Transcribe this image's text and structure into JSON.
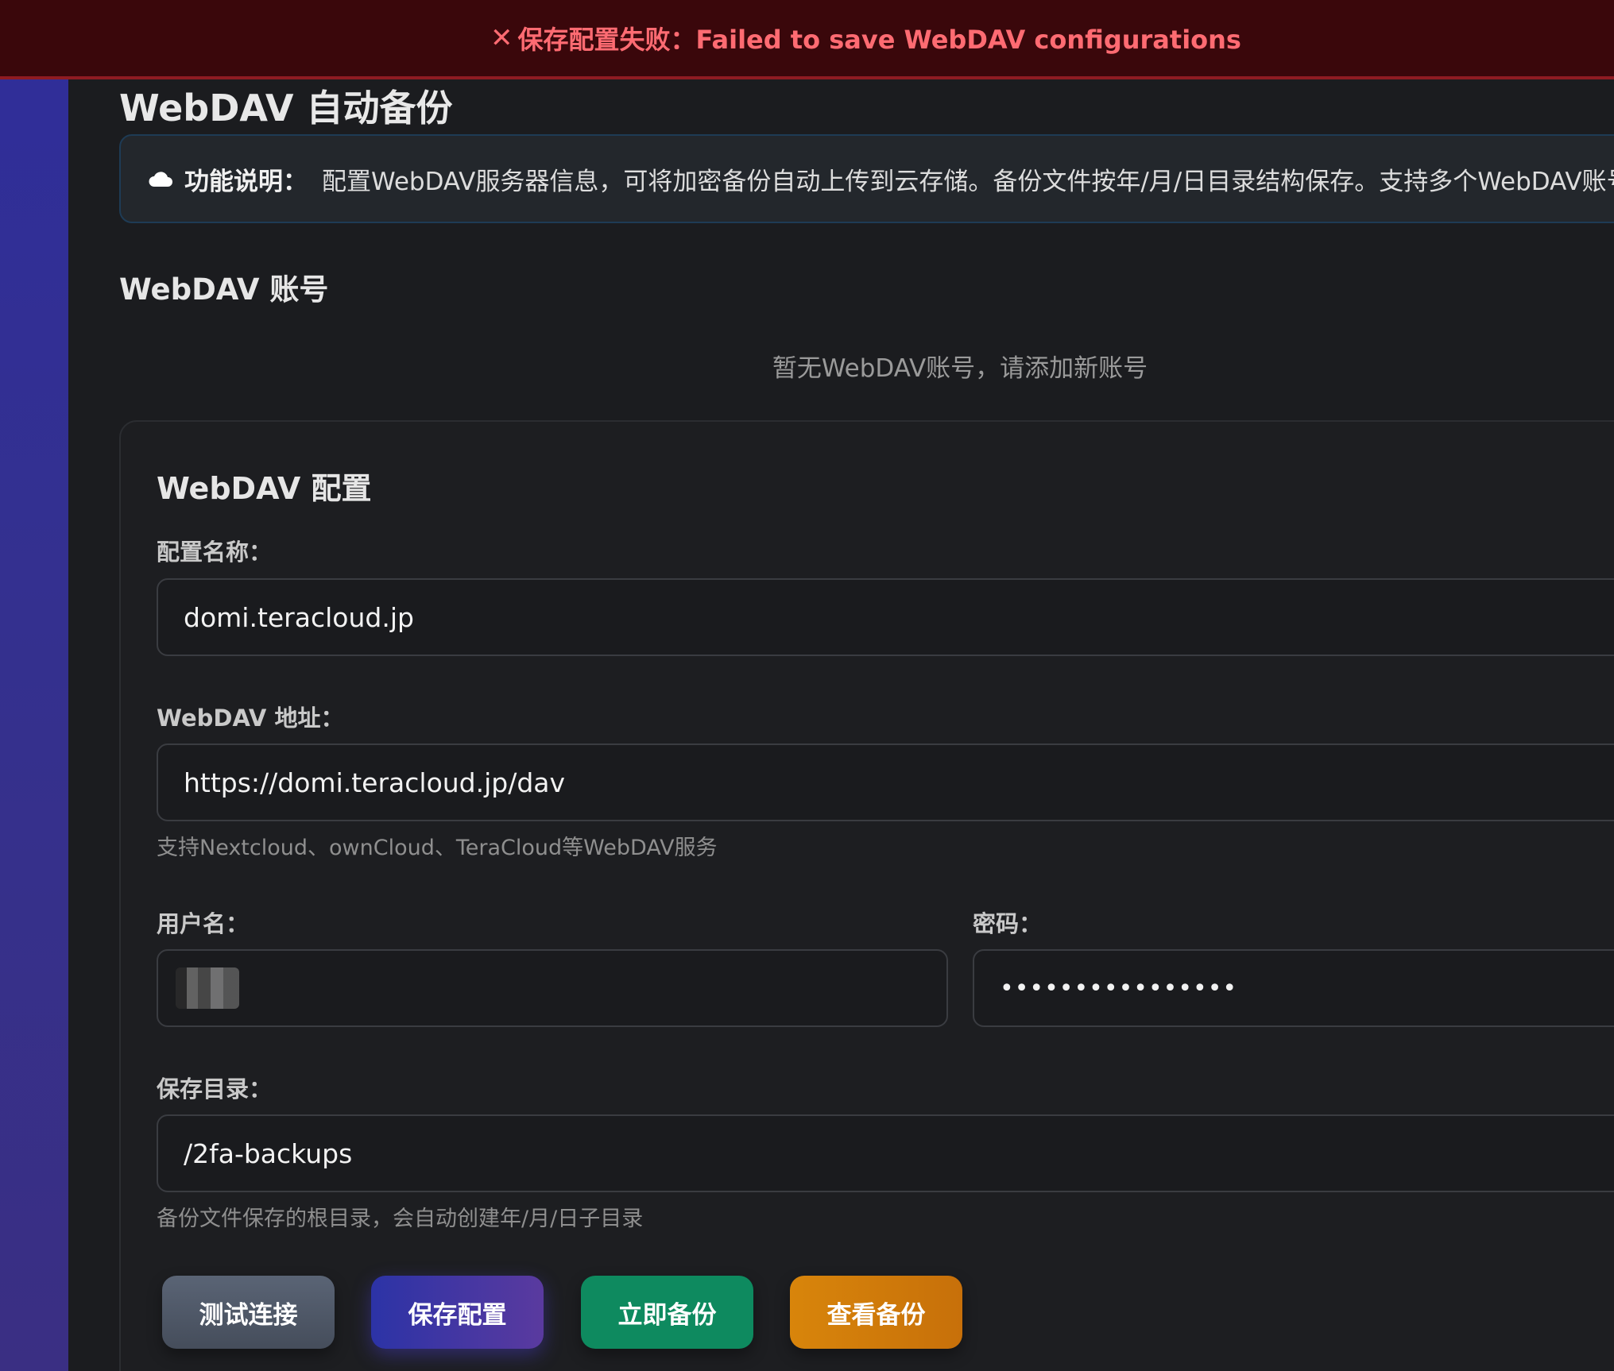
{
  "toast": {
    "icon": "x-icon",
    "symbol": "✕",
    "message": "保存配置失败：Failed to save WebDAV configurations",
    "color": "#ff6b72"
  },
  "page": {
    "title": "WebDAV 自动备份"
  },
  "info": {
    "icon": "cloud-icon",
    "label": "功能说明：",
    "text": "配置WebDAV服务器信息，可将加密备份自动上传到云存储。备份文件按年/月/日目录结构保存。支持多个WebDAV账号"
  },
  "accounts": {
    "title": "WebDAV 账号",
    "empty_message": "暂无WebDAV账号，请添加新账号"
  },
  "config": {
    "title": "WebDAV 配置",
    "name_label": "配置名称：",
    "name_value": "domi.teracloud.jp",
    "url_label": "WebDAV 地址：",
    "url_value": "https://domi.teracloud.jp/dav",
    "url_hint": "支持Nextcloud、ownCloud、TeraCloud等WebDAV服务",
    "username_label": "用户名：",
    "password_label": "密码：",
    "password_value": "••••••••••••••••",
    "dir_label": "保存目录：",
    "dir_value": "/2fa-backups",
    "dir_hint": "备份文件保存的根目录，会自动创建年/月/日子目录"
  },
  "buttons": {
    "test": "测试连接",
    "save": "保存配置",
    "backup_now": "立即备份",
    "view_backups": "查看备份"
  },
  "colors": {
    "toast_bg": "#3a070b",
    "sidebar_gradient": "#2f2e9a",
    "btn_test": "#545d6d",
    "btn_save": "#3b35a3",
    "btn_backup": "#0e8a5f",
    "btn_view": "#d07c0b"
  }
}
